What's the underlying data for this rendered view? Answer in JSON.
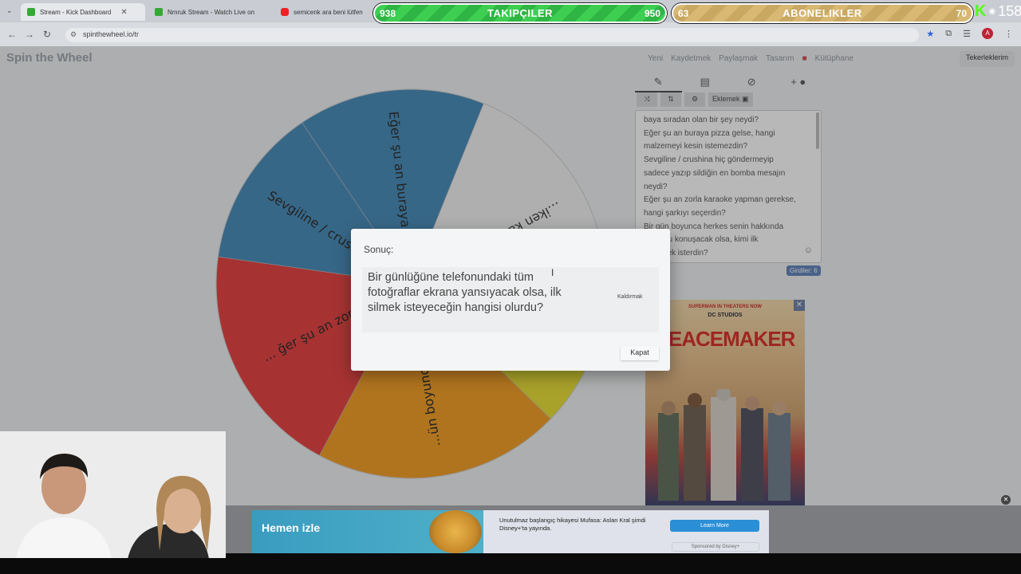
{
  "browser": {
    "tabs": [
      {
        "title": "Stream - Kick Dashboard"
      },
      {
        "title": "Nmruk Stream - Watch Live on"
      },
      {
        "title": "semicenk ara beni lütfen"
      }
    ],
    "url": "spinthewheel.io/tr",
    "profile_initial": "A"
  },
  "overlay": {
    "followers": {
      "label": "TAKIPÇILER",
      "current": "938",
      "goal": "950"
    },
    "subscribers": {
      "label": "ABONELIKLER",
      "current": "63",
      "goal": "70"
    },
    "viewers": "158"
  },
  "site": {
    "logo": "Spin the Wheel",
    "nav": [
      "Yeni",
      "Kaydetmek",
      "Paylaşmak",
      "Tasarım",
      "Kütüphane"
    ],
    "my_wheels": "Tekerleklerim"
  },
  "wheel": {
    "segments": [
      {
        "label": "Eğer şu an buraya...",
        "color": "#3f86b6"
      },
      {
        "label": "...iken kahraman...",
        "color": "#f2f2f2"
      },
      {
        "label": "",
        "color": "#e8dd2c"
      },
      {
        "label": "...ün boyunca h...",
        "color": "#f39a1c"
      },
      {
        "label": "... ğer şu an zorla",
        "color": "#e53a38"
      },
      {
        "label": "Sevgiline / crush...",
        "color": "#3f86b6"
      }
    ]
  },
  "panel": {
    "tools": [
      "Eklemek"
    ],
    "entries": [
      "baya sıradan olan bir şey neydi?",
      "Eğer şu an buraya pizza gelse, hangi",
      "malzemeyi kesin istemezdin?",
      "Sevgiline / crushina hiç göndermeyip",
      "sadece yazıp sildiğin en bomba mesajın",
      "neydi?",
      "Eğer şu an zorla karaoke yapman gerekse,",
      "hangi şarkıyı seçerdin?",
      "Bir gün boyunca herkes senin hakkında",
      "doğruyu konuşacak olsa, kimi ilk",
      "dinlemek isterdin?"
    ],
    "entries_count": "Girdiler: 6"
  },
  "ad_poster": {
    "brand": "SUPERMAN IN THEATERS NOW",
    "studio": "DC STUDIOS",
    "title": "PEACEMAKER"
  },
  "dialog": {
    "title": "Sonuç:",
    "result": "Bir günlüğüne telefonundaki tüm fotoğraflar ekrana yansıyacak olsa, ilk silmek isteyeceğin hangisi olurdu?",
    "remove_label": "Kaldırmak",
    "close_label": "Kapat"
  },
  "banner": {
    "cta": "Hemen izle",
    "copy": "Unutulmaz başlangıç hikayesi Mufasa: Aslan Kral şimdi Disney+'ta yayında.",
    "learn_more": "Learn More",
    "sponsored": "Sponsored by Disney+"
  }
}
